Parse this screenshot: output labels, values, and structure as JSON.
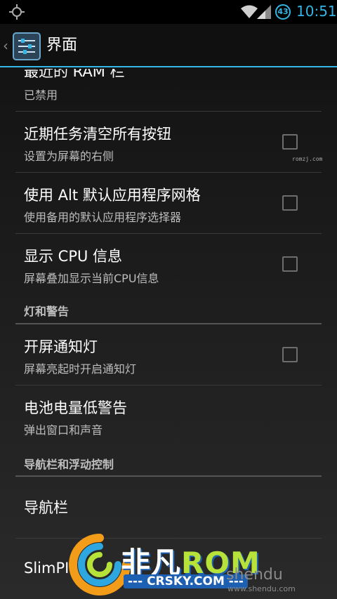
{
  "status_bar": {
    "time": "10:51",
    "battery_level": "43",
    "icons": [
      "gps-icon",
      "wifi-icon",
      "signal-icon",
      "battery-icon"
    ],
    "accent_color": "#33b5e5"
  },
  "action_bar": {
    "title": "界面",
    "app_icon": "settings-sliders-icon",
    "up_icon": "chevron-left-icon"
  },
  "list": {
    "items": [
      {
        "title": "最近的 RAM 栏",
        "summary": "已禁用"
      },
      {
        "title": "近期任务清空所有按钮",
        "summary": "设置为屏幕的右侧",
        "checked": false
      },
      {
        "title": "使用 Alt 默认应用程序网格",
        "summary": "使用备用的默认应用程序选择器",
        "checked": false
      },
      {
        "title": "显示 CPU 信息",
        "summary": "屏幕叠加显示当前CPU信息",
        "checked": false
      },
      {
        "title": "开屏通知灯",
        "summary": "屏幕亮起时开启通知灯",
        "checked": false
      },
      {
        "title": "电池电量低警告",
        "summary": "弹出窗口和声音"
      },
      {
        "title": "导航栏"
      },
      {
        "title": "SlimPIE"
      }
    ],
    "sections": [
      {
        "title": "灯和警告"
      },
      {
        "title": "导航栏和浮动控制"
      }
    ]
  },
  "watermarks": {
    "small": "romzj.com",
    "brand_cn": "非凡",
    "brand_rom": "ROM",
    "crsky": "--- CRSKY.COM ---",
    "shendu": "shendu",
    "shendu_url": "www.shendu.com"
  }
}
